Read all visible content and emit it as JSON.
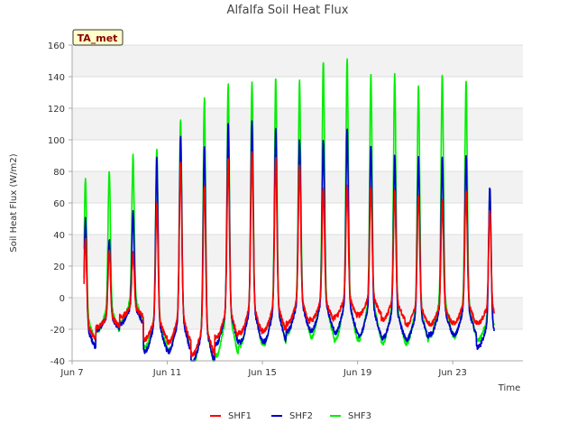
{
  "chart_data": {
    "type": "line",
    "title": "Alfalfa Soil Heat Flux",
    "xlabel": "Time",
    "ylabel": "Soil Heat Flux (W/m2)",
    "badge": "TA_met",
    "ylim": [
      -40,
      160
    ],
    "yticks": [
      -40,
      -20,
      0,
      20,
      40,
      60,
      80,
      100,
      120,
      140,
      160
    ],
    "xlim": [
      "2024-06-07",
      "2024-06-25"
    ],
    "xticks": [
      {
        "date": "2024-06-07",
        "label": "Jun 7"
      },
      {
        "date": "2024-06-11",
        "label": "Jun 11"
      },
      {
        "date": "2024-06-15",
        "label": "Jun 15"
      },
      {
        "date": "2024-06-19",
        "label": "Jun 19"
      },
      {
        "date": "2024-06-23",
        "label": "Jun 23"
      }
    ],
    "grid": true,
    "legend_position": "bottom",
    "series": [
      {
        "name": "SHF1",
        "color": "#ff0000",
        "start": "2024-06-07T12:00",
        "end": "2024-06-24T18:00",
        "daily_peaks": [
          38,
          30,
          28,
          60,
          85,
          72,
          88,
          92,
          88,
          85,
          70,
          72,
          70,
          68,
          65,
          62,
          68,
          55
        ],
        "daily_minima": [
          -22,
          -15,
          -9,
          -20,
          -20,
          -28,
          -17,
          -14,
          -13,
          -9,
          -8,
          -6,
          -5,
          -8,
          -11,
          -11,
          -10,
          -11
        ]
      },
      {
        "name": "SHF2",
        "color": "#0000cc",
        "start": "2024-06-07T12:00",
        "end": "2024-06-24T18:00",
        "daily_peaks": [
          50,
          37,
          54,
          88,
          102,
          96,
          110,
          112,
          107,
          100,
          100,
          107,
          97,
          90,
          88,
          88,
          90,
          70
        ],
        "daily_minima": [
          -26,
          -16,
          -11,
          -25,
          -24,
          -31,
          -19,
          -18,
          -18,
          -12,
          -12,
          -13,
          -15,
          -17,
          -18,
          -15,
          -15,
          -24
        ]
      },
      {
        "name": "SHF3",
        "color": "#00ee00",
        "start": "2024-06-07T12:00",
        "end": "2024-06-24T18:00",
        "daily_peaks": [
          76,
          81,
          90,
          95,
          113,
          126,
          135,
          137,
          139,
          137,
          150,
          151,
          141,
          142,
          134,
          142,
          137,
          70
        ],
        "daily_minima": [
          -20,
          -14,
          -8,
          -22,
          -22,
          -31,
          -24,
          -18,
          -17,
          -11,
          -12,
          -14,
          -14,
          -16,
          -17,
          -12,
          -13,
          -20
        ]
      }
    ]
  }
}
